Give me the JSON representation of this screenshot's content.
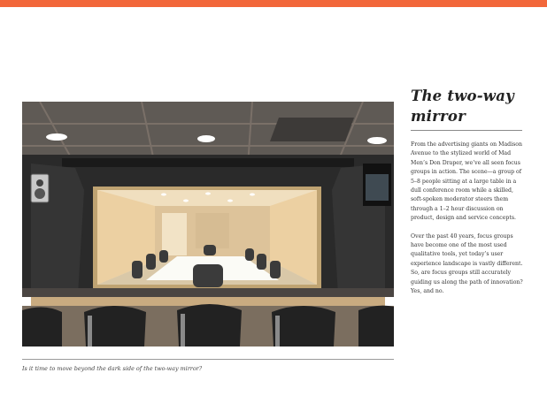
{
  "accent_color": "#f2673a",
  "article": {
    "title_line1": "The two-way",
    "title_line2": "mirror",
    "paragraphs": [
      "From the advertising giants on Madison Avenue to the stylized world of Mad Men’s Don Draper, we’ve all seen focus groups in action. The scene—a group of 5–8 people sitting at a large table in a dull conference room while a skilled, soft-spoken moderator steers them through a 1–2 hour discussion on product, design and service concepts.",
      "Over the past 40 years, focus groups have become one of the most used qualitative tools, yet today’s user experience landscape is vastly different. So, are focus groups still accurately guiding us along the path of innovation?  Yes, and no."
    ]
  },
  "figure": {
    "caption": "Is it time to move beyond the dark side of the two-way mirror?"
  }
}
